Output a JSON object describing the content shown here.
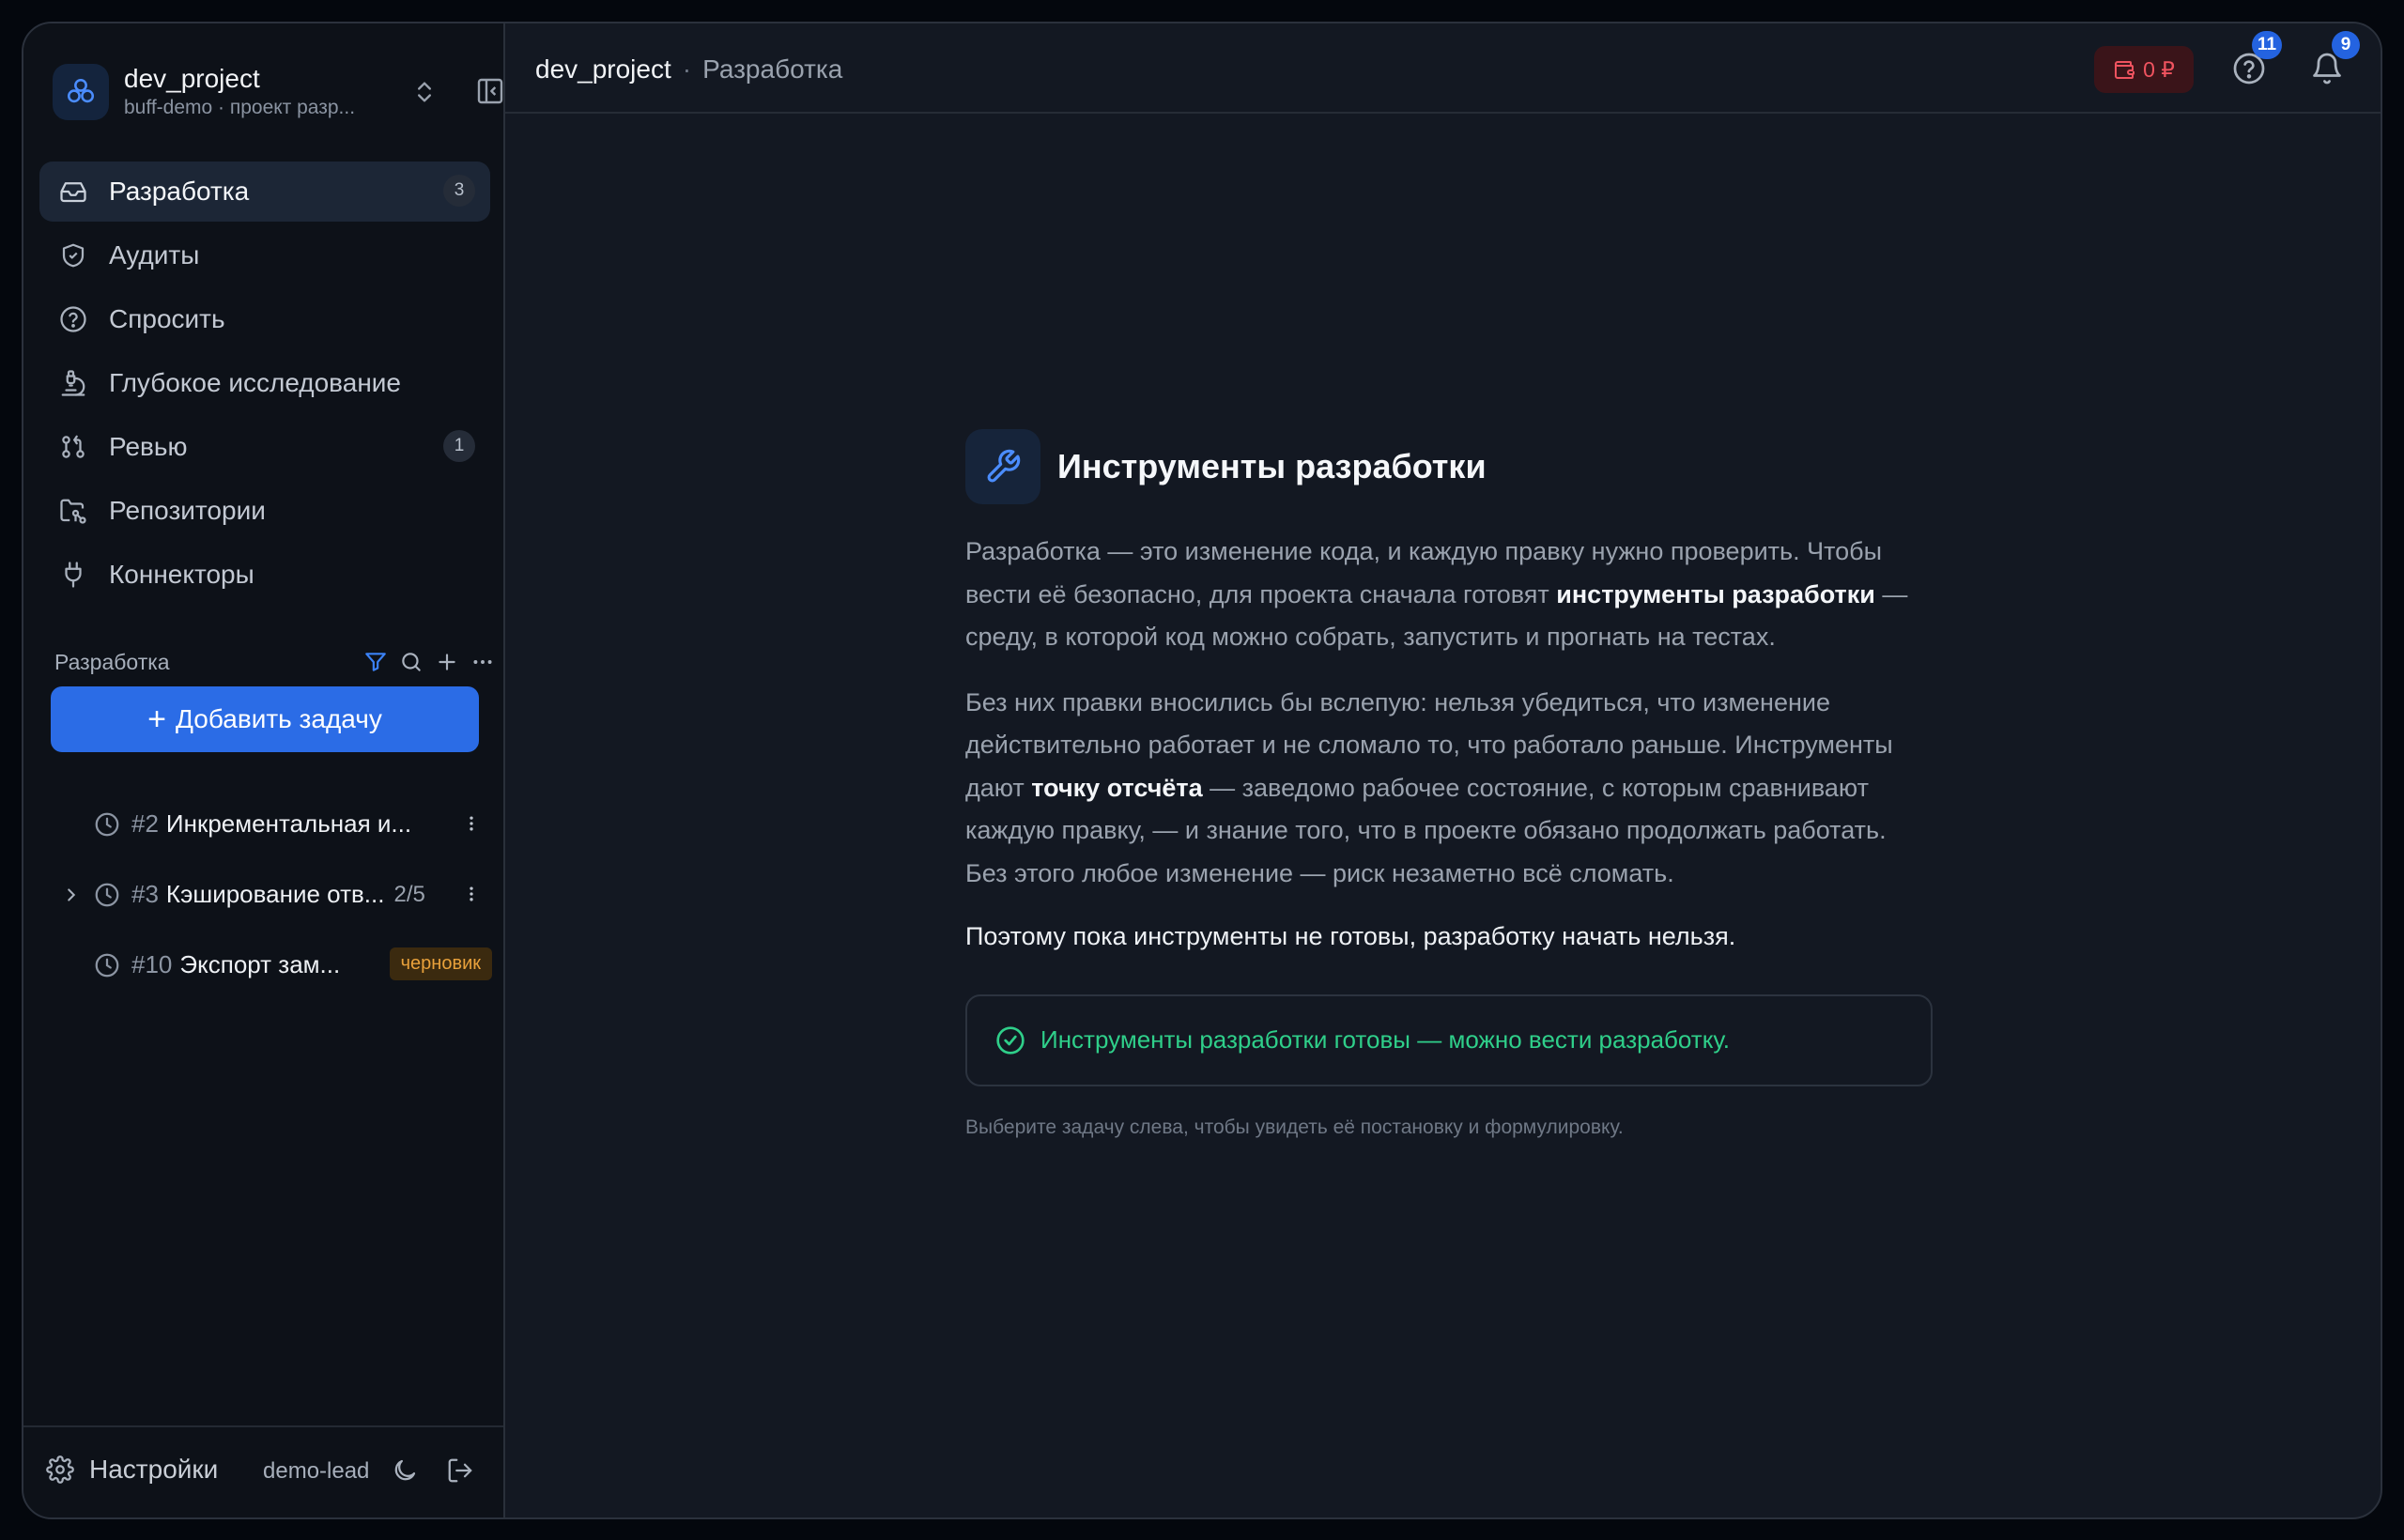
{
  "project": {
    "name": "dev_project",
    "subtitle": "buff-demo · проект разр..."
  },
  "nav": [
    {
      "label": "Разработка",
      "icon": "inbox-icon",
      "badge": "3",
      "active": true
    },
    {
      "label": "Аудиты",
      "icon": "shield-icon",
      "badge": null
    },
    {
      "label": "Спросить",
      "icon": "question-icon",
      "badge": null
    },
    {
      "label": "Глубокое исследование",
      "icon": "microscope-icon",
      "badge": null
    },
    {
      "label": "Ревью",
      "icon": "git-pull-request-icon",
      "badge": "1"
    },
    {
      "label": "Репозитории",
      "icon": "folder-git-icon",
      "badge": null
    },
    {
      "label": "Коннекторы",
      "icon": "plug-icon",
      "badge": null
    }
  ],
  "section": {
    "title": "Разработка",
    "add_label": "Добавить задачу"
  },
  "tasks": [
    {
      "num": "#2",
      "title": "Инкрементальная и...",
      "count": "",
      "tag": ""
    },
    {
      "num": "#3",
      "title": "Кэширование отв...",
      "count": "2/5",
      "tag": ""
    },
    {
      "num": "#10",
      "title": "Экспорт зам...",
      "count": "",
      "tag": "черновик"
    }
  ],
  "footer": {
    "settings_label": "Настройки",
    "user": "demo-lead"
  },
  "topbar": {
    "crumb_project": "dev_project",
    "crumb_sep": "·",
    "crumb_page": "Разработка",
    "balance": "0 ₽",
    "help_badge": "11",
    "notif_badge": "9"
  },
  "content": {
    "title": "Инструменты разработки",
    "p1_a": "Разработка — это изменение кода, и каждую правку нужно проверить. Чтобы вести её безопасно, для проекта сначала готовят ",
    "p1_b": "инструменты разработки",
    "p1_c": " — среду, в которой код можно собрать, запустить и прогнать на тестах.",
    "p2_a": "Без них правки вносились бы вслепую: нельзя убедиться, что изменение действительно работает и не сломало то, что работало раньше. Инструменты дают ",
    "p2_b": "точку отсчёта",
    "p2_c": " — заведомо рабочее состояние, с которым сравнивают каждую правку, — и знание того, что в проекте обязано продолжать работать. Без этого любое изменение — риск незаметно всё сломать.",
    "p3": "Поэтому пока инструменты не готовы, разработку начать нельзя.",
    "ready": "Инструменты разработки готовы — можно вести разработку.",
    "hint": "Выберите задачу слева, чтобы увидеть её постановку и формулировку."
  },
  "colors": {
    "accent": "#2b6ce6",
    "success": "#2fcf8a",
    "danger": "#f0535f",
    "draft": "#e9a13b"
  }
}
